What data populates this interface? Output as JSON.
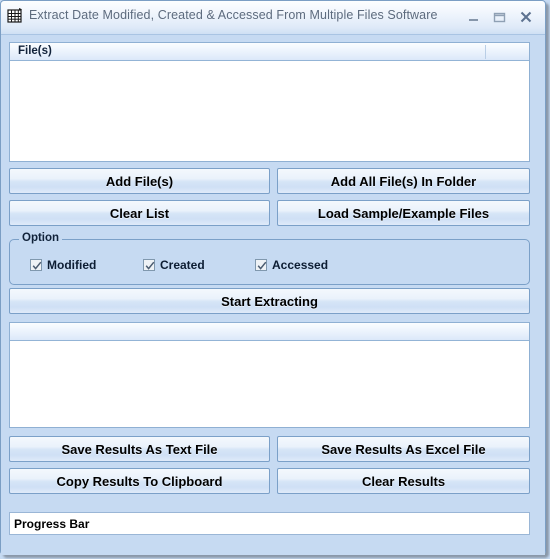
{
  "window": {
    "title": "Extract Date Modified, Created & Accessed From Multiple Files Software",
    "icon": "grid-table-icon",
    "controls": {
      "minimize": "minimize-icon",
      "maximize": "maximize-icon",
      "close": "close-icon"
    },
    "accent_color": "#c6daf2",
    "border_color": "#7b9ec4"
  },
  "file_list": {
    "columns": [
      "File(s)",
      ""
    ],
    "rows": []
  },
  "file_buttons": {
    "add_files": "Add File(s)",
    "add_all_files_in_folder": "Add All File(s) In Folder",
    "clear_list": "Clear List",
    "load_sample_files": "Load Sample/Example Files"
  },
  "option_group": {
    "title": "Option",
    "checkboxes": [
      {
        "label": "Modified",
        "checked": true
      },
      {
        "label": "Created",
        "checked": true
      },
      {
        "label": "Accessed",
        "checked": true
      }
    ]
  },
  "action": {
    "start_extracting": "Start Extracting"
  },
  "results_list": {
    "columns": [
      ""
    ],
    "rows": []
  },
  "result_buttons": {
    "save_as_text": "Save Results As Text File",
    "save_as_excel": "Save Results As Excel File",
    "copy_to_clipboard": "Copy Results To Clipboard",
    "clear_results": "Clear Results"
  },
  "status": {
    "progress_label": "Progress Bar",
    "progress_percent": 0
  }
}
